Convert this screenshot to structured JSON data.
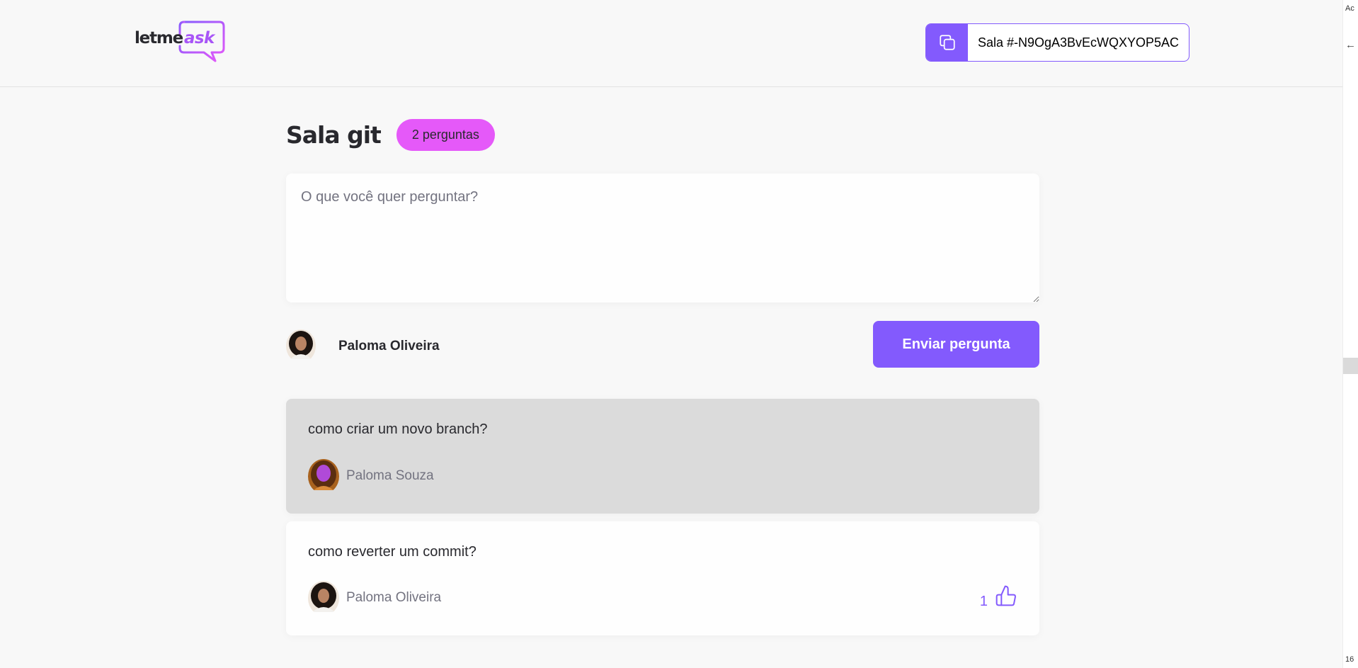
{
  "header": {
    "logo": {
      "text_dark": "letme",
      "text_accent": "ask"
    },
    "room_code": {
      "label": "Sala #-N9OgA3BvEcWQXYOP5AC",
      "icon": "copy-icon"
    }
  },
  "room": {
    "title": "Sala git",
    "question_count_badge": "2 perguntas"
  },
  "form": {
    "placeholder": "O que você quer perguntar?",
    "value": "",
    "user_name": "Paloma Oliveira",
    "submit_label": "Enviar pergunta"
  },
  "questions": [
    {
      "content": "como criar um novo branch?",
      "author": "Paloma Souza",
      "highlighted": true
    },
    {
      "content": "como reverter um commit?",
      "author": "Paloma Oliveira",
      "highlighted": false,
      "like_count": "1",
      "like_icon": "thumbs-up-icon"
    }
  ],
  "side_panel": {
    "top_text": "Ac",
    "arrow": "←",
    "bottom_text": "16"
  },
  "colors": {
    "accent": "#835afd",
    "badge": "#e559f9",
    "background": "#f8f8f8",
    "highlight": "#dbdbdb",
    "muted_text": "#737380"
  }
}
